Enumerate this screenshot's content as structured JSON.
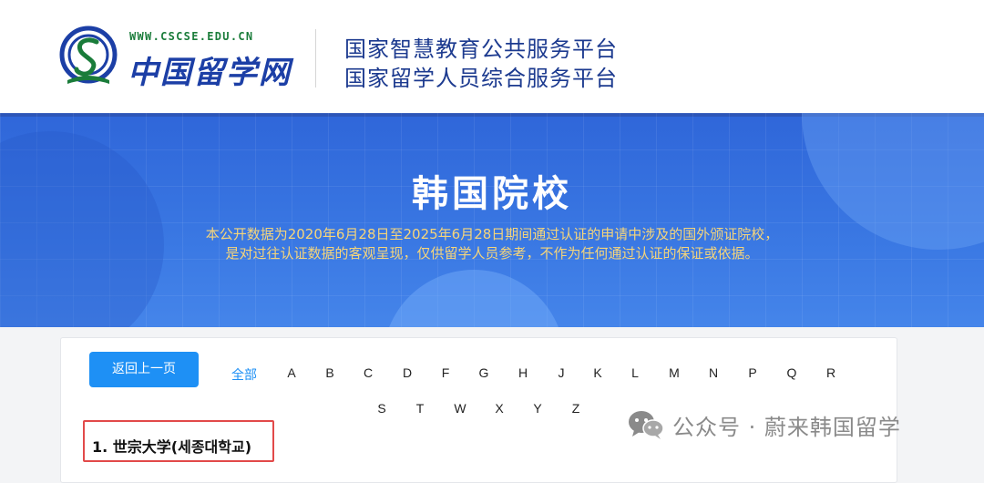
{
  "header": {
    "logo_url": "WWW.CSCSE.EDU.CN",
    "logo_name": "中国留学网",
    "tagline_1": "国家智慧教育公共服务平台",
    "tagline_2": "国家留学人员综合服务平台"
  },
  "banner": {
    "title": "韩国院校",
    "desc_1": "本公开数据为2020年6月28日至2025年6月28日期间通过认证的申请中涉及的国外颁证院校，",
    "desc_2": "是对过往认证数据的客观呈现，仅供留学人员参考，不作为任何通过认证的保证或依据。"
  },
  "nav": {
    "back_label": "返回上一页",
    "all_label": "全部",
    "letters_row1": [
      "A",
      "B",
      "C",
      "D",
      "F",
      "G",
      "H",
      "J",
      "K",
      "L",
      "M",
      "N",
      "P",
      "Q",
      "R"
    ],
    "letters_row2": [
      "S",
      "T",
      "W",
      "X",
      "Y",
      "Z"
    ]
  },
  "schools": [
    {
      "label": "1.  世宗大学(세종대학교)"
    }
  ],
  "watermark": {
    "text": "公众号 · 蔚来韩国留学",
    "icon": "wechat-icon"
  },
  "colors": {
    "accent": "#1e90f5",
    "banner": "#3a78e3",
    "banner_desc": "#f6d57a",
    "highlight_border": "#e24a4a",
    "header_text": "#1c3a8f"
  }
}
